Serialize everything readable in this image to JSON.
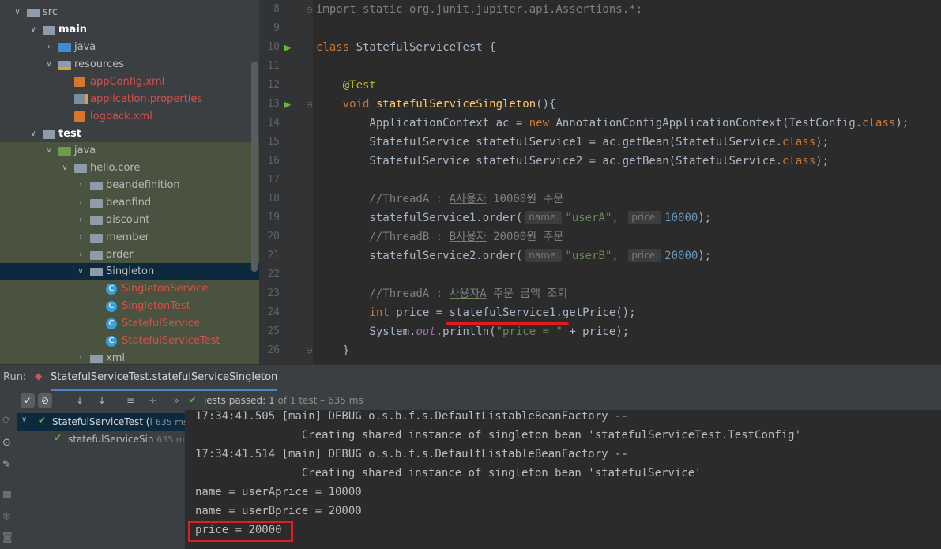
{
  "project_tree": {
    "items": [
      {
        "label": "src",
        "depth": 0,
        "arrow": "expanded",
        "icon": "folder-icon",
        "style": "plain",
        "bg": "none"
      },
      {
        "label": "main",
        "depth": 1,
        "arrow": "expanded",
        "icon": "folder-icon",
        "style": "bold",
        "bg": "none"
      },
      {
        "label": "java",
        "depth": 2,
        "arrow": "collapsed",
        "icon": "source-folder-icon",
        "style": "plain",
        "bg": "none"
      },
      {
        "label": "resources",
        "depth": 2,
        "arrow": "expanded",
        "icon": "resources-folder-icon",
        "style": "plain",
        "bg": "none"
      },
      {
        "label": "appConfig.xml",
        "depth": 3,
        "arrow": "none",
        "icon": "xml-file-icon",
        "style": "red",
        "bg": "none"
      },
      {
        "label": "application.properties",
        "depth": 3,
        "arrow": "none",
        "icon": "properties-file-icon",
        "style": "red",
        "bg": "none"
      },
      {
        "label": "logback.xml",
        "depth": 3,
        "arrow": "none",
        "icon": "xml-file-icon",
        "style": "red",
        "bg": "none"
      },
      {
        "label": "test",
        "depth": 1,
        "arrow": "expanded",
        "icon": "folder-icon",
        "style": "bold",
        "bg": "none"
      },
      {
        "label": "java",
        "depth": 2,
        "arrow": "expanded",
        "icon": "test-folder-icon",
        "style": "plain",
        "bg": "test"
      },
      {
        "label": "hello.core",
        "depth": 3,
        "arrow": "expanded",
        "icon": "package-icon",
        "style": "plain",
        "bg": "test"
      },
      {
        "label": "beandefinition",
        "depth": 4,
        "arrow": "collapsed",
        "icon": "package-icon",
        "style": "plain",
        "bg": "test"
      },
      {
        "label": "beanfind",
        "depth": 4,
        "arrow": "collapsed",
        "icon": "package-icon",
        "style": "plain",
        "bg": "test"
      },
      {
        "label": "discount",
        "depth": 4,
        "arrow": "collapsed",
        "icon": "package-icon",
        "style": "plain",
        "bg": "test"
      },
      {
        "label": "member",
        "depth": 4,
        "arrow": "collapsed",
        "icon": "package-icon",
        "style": "plain",
        "bg": "test"
      },
      {
        "label": "order",
        "depth": 4,
        "arrow": "collapsed",
        "icon": "package-icon",
        "style": "plain",
        "bg": "test"
      },
      {
        "label": "Singleton",
        "depth": 4,
        "arrow": "expanded",
        "icon": "package-icon",
        "style": "plain",
        "bg": "selected"
      },
      {
        "label": "SingletonService",
        "depth": 5,
        "arrow": "none",
        "icon": "class-icon",
        "style": "red",
        "bg": "test"
      },
      {
        "label": "SingletonTest",
        "depth": 5,
        "arrow": "none",
        "icon": "class-icon",
        "style": "red",
        "bg": "test"
      },
      {
        "label": "StatefulService",
        "depth": 5,
        "arrow": "none",
        "icon": "class-icon",
        "style": "red",
        "bg": "test"
      },
      {
        "label": "StatefulServiceTest",
        "depth": 5,
        "arrow": "none",
        "icon": "class-icon",
        "style": "red",
        "bg": "test"
      },
      {
        "label": "xml",
        "depth": 4,
        "arrow": "collapsed",
        "icon": "package-icon",
        "style": "plain",
        "bg": "test"
      }
    ]
  },
  "editor": {
    "line_numbers": [
      "8",
      "9",
      "10",
      "11",
      "12",
      "13",
      "14",
      "15",
      "16",
      "17",
      "18",
      "19",
      "20",
      "21",
      "22",
      "23",
      "24",
      "25",
      "26"
    ],
    "lines": [
      [
        {
          "t": "import static org.junit.jupiter.api.Assertions.*;",
          "c": "cm"
        }
      ],
      [],
      [
        {
          "t": "class ",
          "c": "kw"
        },
        {
          "t": "StatefulServiceTest {",
          "c": ""
        }
      ],
      [],
      [
        {
          "t": "    @Test",
          "c": "ann"
        }
      ],
      [
        {
          "t": "    void ",
          "c": "kw"
        },
        {
          "t": "statefulServiceSingleton",
          "c": "fn"
        },
        {
          "t": "(){",
          "c": ""
        }
      ],
      [
        {
          "t": "        ApplicationContext ac = ",
          "c": ""
        },
        {
          "t": "new ",
          "c": "kw"
        },
        {
          "t": "AnnotationConfigApplicationContext(TestConfig.",
          "c": ""
        },
        {
          "t": "class",
          "c": "kw"
        },
        {
          "t": ");",
          "c": ""
        }
      ],
      [
        {
          "t": "        StatefulService statefulService1 = ac.getBean(StatefulService.",
          "c": ""
        },
        {
          "t": "class",
          "c": "kw"
        },
        {
          "t": ");",
          "c": ""
        }
      ],
      [
        {
          "t": "        StatefulService statefulService2 = ac.getBean(StatefulService.",
          "c": ""
        },
        {
          "t": "class",
          "c": "kw"
        },
        {
          "t": ");",
          "c": ""
        }
      ],
      [],
      [
        {
          "t": "        //ThreadA : ",
          "c": "cm"
        },
        {
          "t": "A사용자",
          "c": "cm uline"
        },
        {
          "t": " 10000원 주문",
          "c": "cm"
        }
      ],
      [
        {
          "t": "        statefulService1.order(",
          "c": ""
        },
        {
          "hint": "name:"
        },
        {
          "t": "\"userA\"",
          "c": "str"
        },
        {
          "t": ", ",
          "c": "kw"
        },
        {
          "hint": "price:"
        },
        {
          "t": "10000",
          "c": "num"
        },
        {
          "t": ");",
          "c": ""
        }
      ],
      [
        {
          "t": "        //ThreadB : ",
          "c": "cm"
        },
        {
          "t": "B사용자",
          "c": "cm uline"
        },
        {
          "t": " 20000원 주문",
          "c": "cm"
        }
      ],
      [
        {
          "t": "        statefulService2.order(",
          "c": ""
        },
        {
          "hint": "name:"
        },
        {
          "t": "\"userB\"",
          "c": "str"
        },
        {
          "t": ", ",
          "c": "kw"
        },
        {
          "hint": "price:"
        },
        {
          "t": "20000",
          "c": "num"
        },
        {
          "t": ");",
          "c": ""
        }
      ],
      [],
      [
        {
          "t": "        //ThreadA : ",
          "c": "cm"
        },
        {
          "t": "사용자A",
          "c": "cm uline"
        },
        {
          "t": " 주문 금액 조회",
          "c": "cm"
        }
      ],
      [
        {
          "t": "        int ",
          "c": "kw"
        },
        {
          "t": "price = statefulService1.getPrice();",
          "c": ""
        }
      ],
      [
        {
          "t": "        System.",
          "c": ""
        },
        {
          "t": "out",
          "c": "it"
        },
        {
          "t": ".println(",
          "c": ""
        },
        {
          "t": "\"price = \"",
          "c": "str"
        },
        {
          "t": " + price);",
          "c": ""
        }
      ],
      [
        {
          "t": "    }",
          "c": ""
        }
      ]
    ]
  },
  "run_panel": {
    "run_label": "Run:",
    "tab_label": "StatefulServiceTest.statefulServiceSingleton",
    "close_glyph": "×",
    "more_glyph": "»",
    "status": {
      "prefix": "Tests passed: ",
      "count": "1",
      "suffix": " of 1 test – 635 ms"
    },
    "tests": [
      {
        "label": "StatefulServiceTest (",
        "extra": "I",
        "time": "635 ms",
        "level": 0
      },
      {
        "label": "statefulServiceSin",
        "extra": "",
        "time": "635 ms",
        "level": 1
      }
    ],
    "console": [
      "17:34:41.505 [main] DEBUG o.s.b.f.s.DefaultListableBeanFactory --",
      "                Creating shared instance of singleton bean 'statefulServiceTest.TestConfig'",
      "17:34:41.514 [main] DEBUG o.s.b.f.s.DefaultListableBeanFactory --",
      "                Creating shared instance of singleton bean 'statefulService'",
      "name = userAprice = 10000",
      "name = userBprice = 20000",
      "price = 20000"
    ]
  },
  "colors": {
    "accent_red": "#e31c1c",
    "pass_green": "#5fb832",
    "selection": "#0d293e"
  }
}
